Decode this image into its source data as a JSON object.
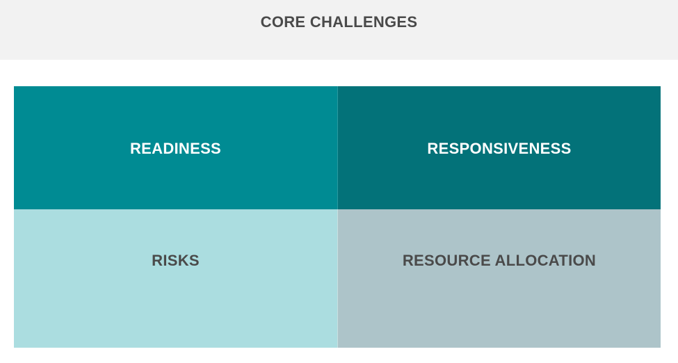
{
  "header": {
    "title": "CORE CHALLENGES"
  },
  "quadrants": [
    {
      "label": "READINESS",
      "color": "#008b93"
    },
    {
      "label": "RESPONSIVENESS",
      "color": "#037279"
    },
    {
      "label": "RISKS",
      "color": "#abdde0"
    },
    {
      "label": "RESOURCE ALLOCATION",
      "color": "#adc4c9"
    }
  ],
  "colors": {
    "header_bg": "#f2f2f2",
    "dark_text": "#4a4a4a",
    "light_text": "#ffffff"
  }
}
